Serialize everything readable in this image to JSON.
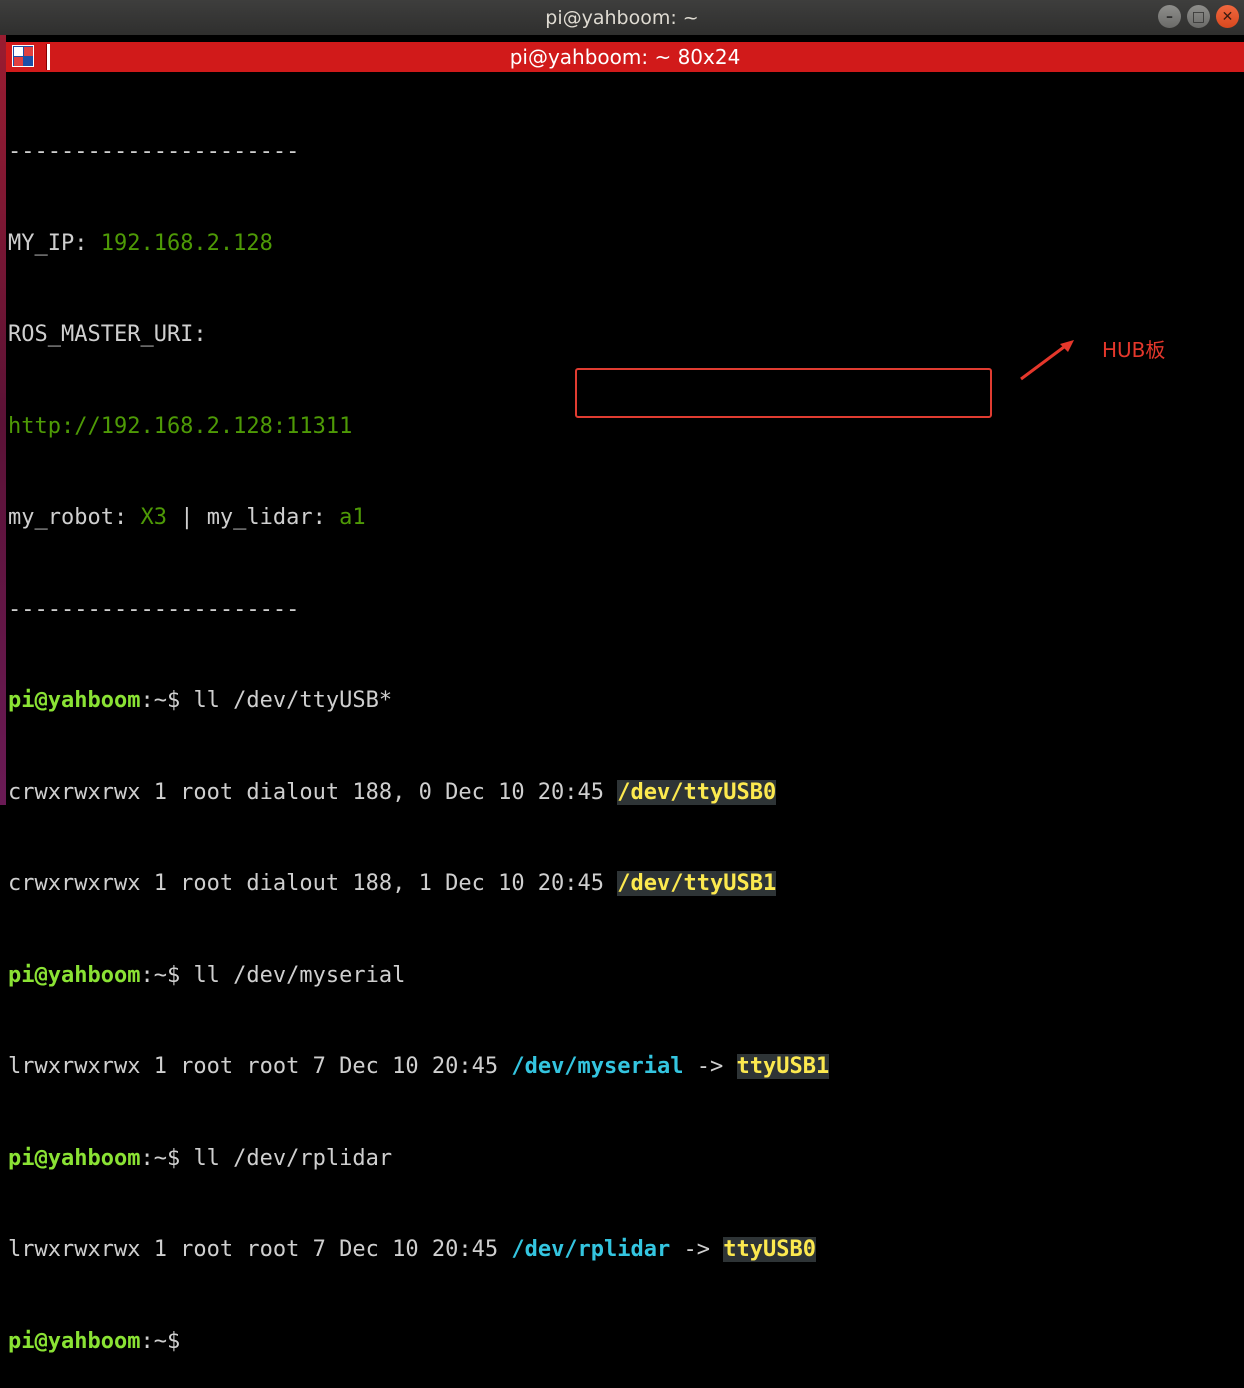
{
  "window": {
    "title": "pi@yahboom: ~"
  },
  "tab": {
    "title": "pi@yahboom: ~ 80x24"
  },
  "terminal": {
    "separator": "----------------------",
    "my_ip_label": "MY_IP: ",
    "my_ip_value": "192.168.2.128",
    "ros_master_label": "ROS_MASTER_URI:",
    "ros_master_value": "http://192.168.2.128:11311",
    "robot_label": "my_robot: ",
    "robot_value": "X3",
    "robot_sep": " | my_lidar: ",
    "lidar_value": "a1",
    "prompt": "pi@yahboom",
    "prompt_suffix": ":~$ ",
    "cmd1": "ll /dev/ttyUSB*",
    "usb0_meta": "crwxrwxrwx 1 root dialout 188, 0 Dec 10 20:45 ",
    "usb0_path": "/dev/ttyUSB0",
    "usb1_meta": "crwxrwxrwx 1 root dialout 188, 1 Dec 10 20:45 ",
    "usb1_path": "/dev/ttyUSB1",
    "cmd2": "ll /dev/myserial",
    "myserial_meta": "lrwxrwxrwx 1 root root 7 Dec 10 20:45 ",
    "myserial_link": "/dev/myserial",
    "arrow": " -> ",
    "myserial_target": "ttyUSB1",
    "cmd3": "ll /dev/rplidar",
    "rplidar_meta": "lrwxrwxrwx 1 root root 7 Dec 10 20:45 ",
    "rplidar_link": "/dev/rplidar",
    "rplidar_target": "ttyUSB0"
  },
  "annotation": {
    "label": "HUB板",
    "color": "#e03c31"
  }
}
